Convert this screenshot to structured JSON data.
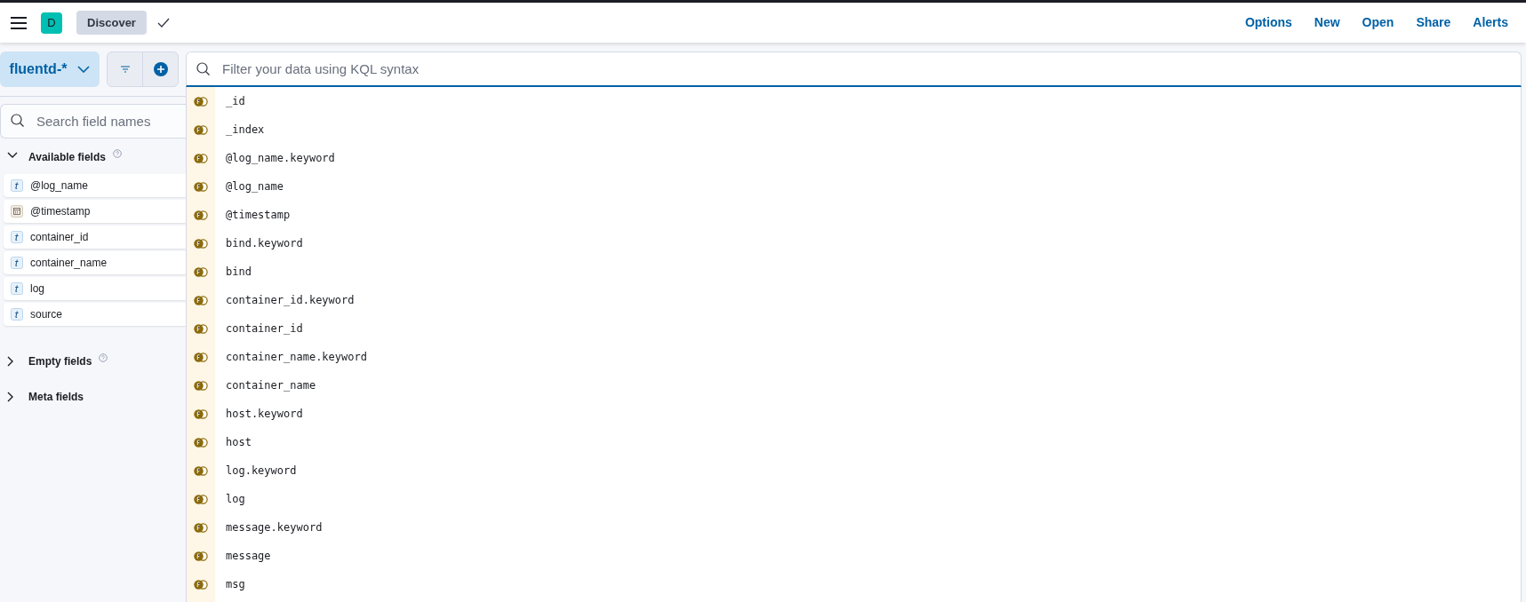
{
  "header": {
    "logo_letter": "D",
    "breadcrumb": "Discover",
    "actions": [
      "Options",
      "New",
      "Open",
      "Share",
      "Alerts"
    ]
  },
  "index_pattern": {
    "label": "fluentd-*"
  },
  "query_bar": {
    "placeholder": "Filter your data using KQL syntax"
  },
  "sidebar": {
    "search": {
      "placeholder": "Search field names"
    },
    "sections": [
      {
        "title": "Available fields",
        "expanded": true,
        "help": true,
        "fields": [
          {
            "name": "@log_name",
            "kind": "string"
          },
          {
            "name": "@timestamp",
            "kind": "date"
          },
          {
            "name": "container_id",
            "kind": "string"
          },
          {
            "name": "container_name",
            "kind": "string"
          },
          {
            "name": "log",
            "kind": "string"
          },
          {
            "name": "source",
            "kind": "string"
          }
        ]
      },
      {
        "title": "Empty fields",
        "expanded": false,
        "help": true
      },
      {
        "title": "Meta fields",
        "expanded": false,
        "help": false
      }
    ]
  },
  "suggestions": [
    {
      "text": "_id"
    },
    {
      "text": "_index"
    },
    {
      "text": "@log_name.keyword"
    },
    {
      "text": "@log_name"
    },
    {
      "text": "@timestamp"
    },
    {
      "text": "bind.keyword"
    },
    {
      "text": "bind"
    },
    {
      "text": "container_id.keyword"
    },
    {
      "text": "container_id"
    },
    {
      "text": "container_name.keyword"
    },
    {
      "text": "container_name"
    },
    {
      "text": "host.keyword"
    },
    {
      "text": "host"
    },
    {
      "text": "log.keyword"
    },
    {
      "text": "log"
    },
    {
      "text": "message.keyword"
    },
    {
      "text": "message"
    },
    {
      "text": "msg"
    }
  ]
}
